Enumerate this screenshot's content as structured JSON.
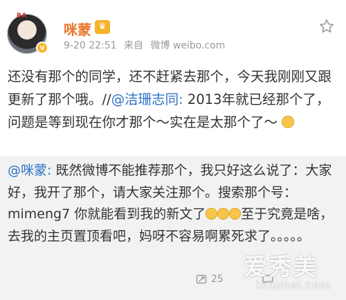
{
  "post": {
    "username": "咪蒙",
    "avatar_tag": "BA",
    "vip_badge": "v",
    "member_icon": "member-crown-icon",
    "timestamp": "9-20 22:51",
    "source_prefix": "来自",
    "source_client": "微博 weibo.com",
    "text_part1": "还没有那个的同学，还不赶紧去那个，今天我刚刚又跟更新了那个哦。//",
    "mention": "@洁珊志同:",
    "text_part2": " 2013年就已经那个了，问题是等到现在你才那个～实在是太那个了～",
    "emoji": "dog-face-emoji"
  },
  "quote": {
    "mention": "@咪蒙:",
    "text_part1": " 既然微博不能推荐那个，我只好这么说了：大家好，我开了那个，请大家关注那个。搜索那个号：mimeng7 你就能看到我的新文了",
    "text_part2": "至于究竟是啥，去我的主页置顶看吧，妈呀不容易啊累死求了。。。。。",
    "repost_count": "25",
    "emojis": [
      "laugh-emoji",
      "laugh-emoji",
      "laugh-emoji"
    ]
  },
  "watermark": {
    "main": "爱秀美",
    "sub": "ixiumei.com"
  },
  "colors": {
    "username": "#e8772c",
    "link": "#2d72c4",
    "quote_bg": "#f2f2f2"
  }
}
